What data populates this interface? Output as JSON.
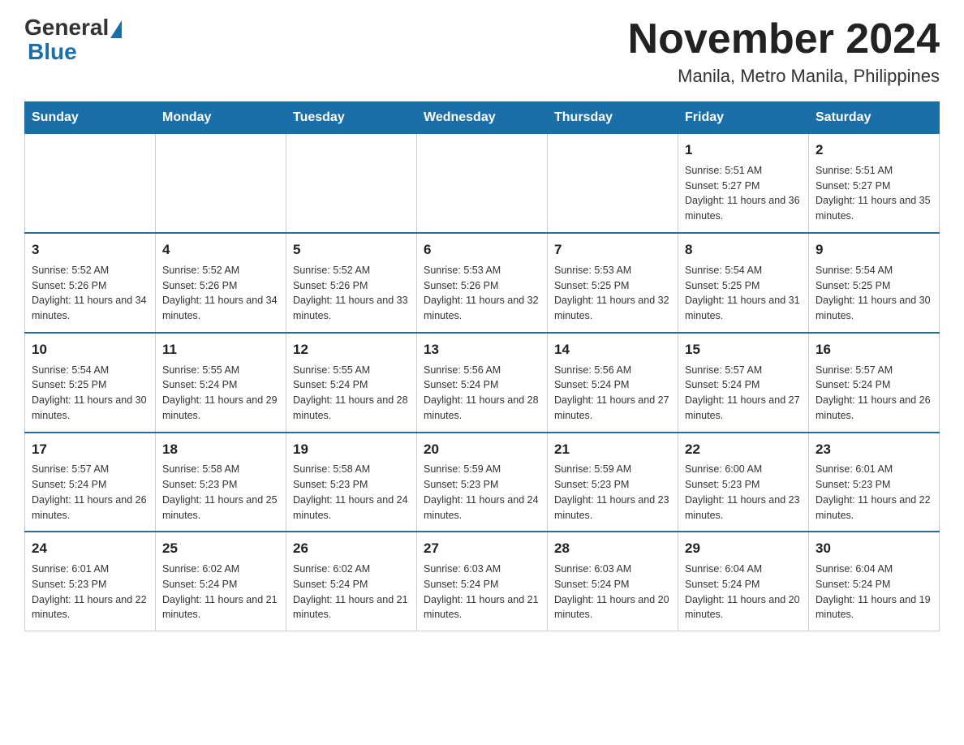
{
  "header": {
    "logo_general": "General",
    "logo_blue": "Blue",
    "month_year": "November 2024",
    "location": "Manila, Metro Manila, Philippines"
  },
  "days_of_week": [
    "Sunday",
    "Monday",
    "Tuesday",
    "Wednesday",
    "Thursday",
    "Friday",
    "Saturday"
  ],
  "weeks": [
    [
      {
        "day": "",
        "info": ""
      },
      {
        "day": "",
        "info": ""
      },
      {
        "day": "",
        "info": ""
      },
      {
        "day": "",
        "info": ""
      },
      {
        "day": "",
        "info": ""
      },
      {
        "day": "1",
        "info": "Sunrise: 5:51 AM\nSunset: 5:27 PM\nDaylight: 11 hours and 36 minutes."
      },
      {
        "day": "2",
        "info": "Sunrise: 5:51 AM\nSunset: 5:27 PM\nDaylight: 11 hours and 35 minutes."
      }
    ],
    [
      {
        "day": "3",
        "info": "Sunrise: 5:52 AM\nSunset: 5:26 PM\nDaylight: 11 hours and 34 minutes."
      },
      {
        "day": "4",
        "info": "Sunrise: 5:52 AM\nSunset: 5:26 PM\nDaylight: 11 hours and 34 minutes."
      },
      {
        "day": "5",
        "info": "Sunrise: 5:52 AM\nSunset: 5:26 PM\nDaylight: 11 hours and 33 minutes."
      },
      {
        "day": "6",
        "info": "Sunrise: 5:53 AM\nSunset: 5:26 PM\nDaylight: 11 hours and 32 minutes."
      },
      {
        "day": "7",
        "info": "Sunrise: 5:53 AM\nSunset: 5:25 PM\nDaylight: 11 hours and 32 minutes."
      },
      {
        "day": "8",
        "info": "Sunrise: 5:54 AM\nSunset: 5:25 PM\nDaylight: 11 hours and 31 minutes."
      },
      {
        "day": "9",
        "info": "Sunrise: 5:54 AM\nSunset: 5:25 PM\nDaylight: 11 hours and 30 minutes."
      }
    ],
    [
      {
        "day": "10",
        "info": "Sunrise: 5:54 AM\nSunset: 5:25 PM\nDaylight: 11 hours and 30 minutes."
      },
      {
        "day": "11",
        "info": "Sunrise: 5:55 AM\nSunset: 5:24 PM\nDaylight: 11 hours and 29 minutes."
      },
      {
        "day": "12",
        "info": "Sunrise: 5:55 AM\nSunset: 5:24 PM\nDaylight: 11 hours and 28 minutes."
      },
      {
        "day": "13",
        "info": "Sunrise: 5:56 AM\nSunset: 5:24 PM\nDaylight: 11 hours and 28 minutes."
      },
      {
        "day": "14",
        "info": "Sunrise: 5:56 AM\nSunset: 5:24 PM\nDaylight: 11 hours and 27 minutes."
      },
      {
        "day": "15",
        "info": "Sunrise: 5:57 AM\nSunset: 5:24 PM\nDaylight: 11 hours and 27 minutes."
      },
      {
        "day": "16",
        "info": "Sunrise: 5:57 AM\nSunset: 5:24 PM\nDaylight: 11 hours and 26 minutes."
      }
    ],
    [
      {
        "day": "17",
        "info": "Sunrise: 5:57 AM\nSunset: 5:24 PM\nDaylight: 11 hours and 26 minutes."
      },
      {
        "day": "18",
        "info": "Sunrise: 5:58 AM\nSunset: 5:23 PM\nDaylight: 11 hours and 25 minutes."
      },
      {
        "day": "19",
        "info": "Sunrise: 5:58 AM\nSunset: 5:23 PM\nDaylight: 11 hours and 24 minutes."
      },
      {
        "day": "20",
        "info": "Sunrise: 5:59 AM\nSunset: 5:23 PM\nDaylight: 11 hours and 24 minutes."
      },
      {
        "day": "21",
        "info": "Sunrise: 5:59 AM\nSunset: 5:23 PM\nDaylight: 11 hours and 23 minutes."
      },
      {
        "day": "22",
        "info": "Sunrise: 6:00 AM\nSunset: 5:23 PM\nDaylight: 11 hours and 23 minutes."
      },
      {
        "day": "23",
        "info": "Sunrise: 6:01 AM\nSunset: 5:23 PM\nDaylight: 11 hours and 22 minutes."
      }
    ],
    [
      {
        "day": "24",
        "info": "Sunrise: 6:01 AM\nSunset: 5:23 PM\nDaylight: 11 hours and 22 minutes."
      },
      {
        "day": "25",
        "info": "Sunrise: 6:02 AM\nSunset: 5:24 PM\nDaylight: 11 hours and 21 minutes."
      },
      {
        "day": "26",
        "info": "Sunrise: 6:02 AM\nSunset: 5:24 PM\nDaylight: 11 hours and 21 minutes."
      },
      {
        "day": "27",
        "info": "Sunrise: 6:03 AM\nSunset: 5:24 PM\nDaylight: 11 hours and 21 minutes."
      },
      {
        "day": "28",
        "info": "Sunrise: 6:03 AM\nSunset: 5:24 PM\nDaylight: 11 hours and 20 minutes."
      },
      {
        "day": "29",
        "info": "Sunrise: 6:04 AM\nSunset: 5:24 PM\nDaylight: 11 hours and 20 minutes."
      },
      {
        "day": "30",
        "info": "Sunrise: 6:04 AM\nSunset: 5:24 PM\nDaylight: 11 hours and 19 minutes."
      }
    ]
  ]
}
